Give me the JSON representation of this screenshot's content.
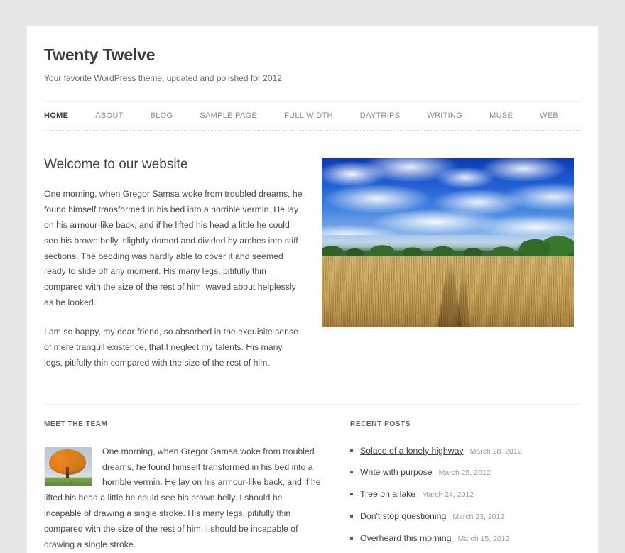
{
  "site": {
    "title": "Twenty Twelve",
    "description": "Your favorite WordPress theme, updated and polished for 2012."
  },
  "nav": {
    "items": [
      {
        "label": "HOME",
        "current": true
      },
      {
        "label": "ABOUT",
        "current": false
      },
      {
        "label": "BLOG",
        "current": false
      },
      {
        "label": "SAMPLE PAGE",
        "current": false
      },
      {
        "label": "FULL WIDTH",
        "current": false
      },
      {
        "label": "DAYTRIPS",
        "current": false
      },
      {
        "label": "WRITING",
        "current": false
      },
      {
        "label": "MUSE",
        "current": false
      },
      {
        "label": "WEB",
        "current": false
      }
    ]
  },
  "front": {
    "entry_title": "Welcome to our website",
    "paragraph_1": "One morning, when Gregor Samsa woke from troubled dreams, he found himself transformed in his bed into a horrible vermin. He lay on his armour-like back, and if he lifted his head a little he could see his brown belly, slightly domed and divided by arches into stiff sections. The bedding was hardly able to cover it and seemed ready to slide off any moment. His many legs, pitifully thin compared with the size of the rest of him, waved about helplessly as he looked.",
    "paragraph_2": "I am so happy, my dear friend, so absorbed in the exquisite sense of mere tranquil existence, that I neglect my talents. His many legs, pitifully thin compared with the size of the rest of him.",
    "hero_image_alt": "wheat field under blue sky with clouds"
  },
  "team_widget": {
    "title": "MEET THE TEAM",
    "thumb_alt": "autumn tree on grass",
    "body": "One morning, when Gregor Samsa woke from troubled dreams, he found himself transformed in his bed into a horrible vermin. He lay on his armour-like back, and if he lifted his head a little he could see his brown belly. I should be incapable of drawing a single stroke. His many legs, pitifully thin compared with the size of the rest of him. I should be incapable of drawing a single stroke."
  },
  "recent_posts": {
    "title": "RECENT POSTS",
    "items": [
      {
        "title": "Solace of a lonely highway",
        "date": "March 28, 2012"
      },
      {
        "title": "Write with purpose",
        "date": "March 25, 2012"
      },
      {
        "title": "Tree on a lake",
        "date": "March 24, 2012"
      },
      {
        "title": "Don't stop questioning",
        "date": "March 23, 2012"
      },
      {
        "title": "Overheard this morning",
        "date": "March 15, 2012"
      }
    ]
  },
  "colors": {
    "page_background": "#e6e6e6",
    "content_background": "#ffffff",
    "title_text": "#3b3b42",
    "body_text": "#4b4b4b",
    "muted_text": "#9a9a9a",
    "nav_inactive": "#8b8b8b",
    "divider": "#ededed"
  }
}
